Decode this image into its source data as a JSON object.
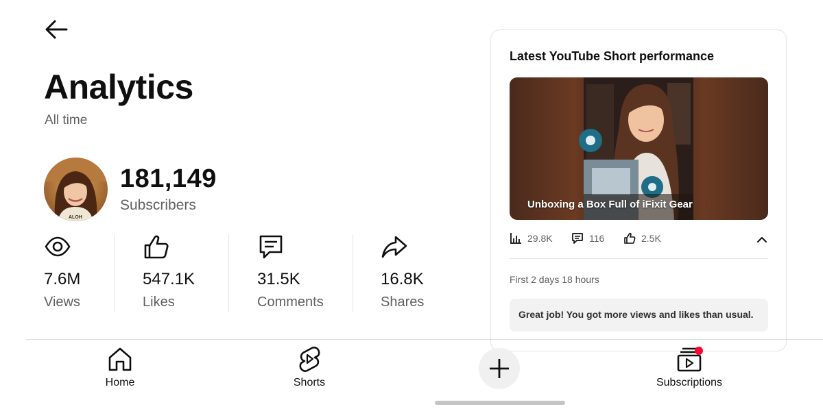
{
  "header": {
    "title": "Analytics",
    "period": "All time"
  },
  "channel": {
    "subscribers_count": "181,149",
    "subscribers_label": "Subscribers"
  },
  "stats": [
    {
      "value": "7.6M",
      "label": "Views",
      "icon": "eye-icon"
    },
    {
      "value": "547.1K",
      "label": "Likes",
      "icon": "thumbs-up-icon"
    },
    {
      "value": "31.5K",
      "label": "Comments",
      "icon": "comment-icon"
    },
    {
      "value": "16.8K",
      "label": "Shares",
      "icon": "share-icon"
    }
  ],
  "short_card": {
    "title": "Latest YouTube Short performance",
    "video_title": "Unboxing a Box Full of iFixit Gear",
    "views": "29.8K",
    "comments": "116",
    "likes": "2.5K",
    "first_period": "First 2 days 18 hours",
    "message": "Great job! You got more views and likes than usual."
  },
  "nav": {
    "home": "Home",
    "shorts": "Shorts",
    "subscriptions": "Subscriptions"
  },
  "colors": {
    "notification_dot": "#ff0033",
    "thumbnail_bg": "#5a3322"
  }
}
